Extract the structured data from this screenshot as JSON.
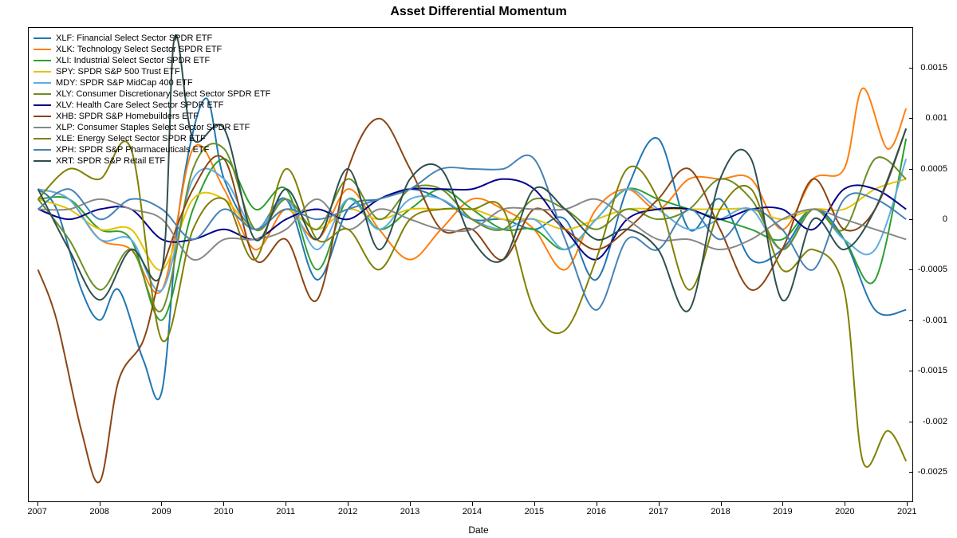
{
  "chart_data": {
    "type": "line",
    "title": "Asset Differential Momentum",
    "xlabel": "Date",
    "ylabel": "",
    "x_years": [
      2007,
      2008,
      2009,
      2010,
      2011,
      2012,
      2013,
      2014,
      2015,
      2016,
      2017,
      2018,
      2019,
      2020,
      2021
    ],
    "x_range": [
      2006.85,
      2021.1
    ],
    "ylim": [
      -0.0028,
      0.0019
    ],
    "yticks": [
      -0.0025,
      -0.002,
      -0.0015,
      -0.001,
      -0.0005,
      0,
      0.0005,
      0.001,
      0.0015
    ],
    "series": [
      {
        "ticker": "XLF",
        "name": "XLF: Financial Select Sector SPDR ETF",
        "color": "#1f77b4",
        "x": [
          2007,
          2007.3,
          2007.7,
          2008,
          2008.3,
          2008.7,
          2009,
          2009.3,
          2009.7,
          2010,
          2010.5,
          2011,
          2011.5,
          2012,
          2012.5,
          2013,
          2013.5,
          2014,
          2014.5,
          2015,
          2015.5,
          2016,
          2016.5,
          2017,
          2017.5,
          2018,
          2018.5,
          2019,
          2019.5,
          2020,
          2020.5,
          2021
        ],
        "y": [
          0.0003,
          0.0001,
          -0.0007,
          -0.001,
          -0.0007,
          -0.0014,
          -0.0017,
          0.0002,
          0.0012,
          0.0004,
          -0.0001,
          0.0002,
          -0.0006,
          0.0001,
          0.0002,
          0.0003,
          0.0002,
          0.0,
          0.0,
          -0.0001,
          0.0,
          -0.0006,
          0.0003,
          0.0008,
          -0.0001,
          0.0002,
          -0.0004,
          -0.0003,
          0.0001,
          -0.0002,
          -0.0009,
          -0.0009
        ]
      },
      {
        "ticker": "XLK",
        "name": "XLK: Technology Select Sector SPDR ETF",
        "color": "#ff7f0e",
        "x": [
          2007,
          2007.5,
          2008,
          2008.5,
          2009,
          2009.5,
          2010,
          2010.5,
          2011,
          2011.5,
          2012,
          2012.5,
          2013,
          2013.5,
          2014,
          2014.5,
          2015,
          2015.5,
          2016,
          2016.5,
          2017,
          2017.5,
          2018,
          2018.5,
          2019,
          2019.5,
          2020,
          2020.3,
          2020.7,
          2021
        ],
        "y": [
          0.0003,
          0.0002,
          -0.0002,
          -0.0003,
          -0.0007,
          0.0007,
          0.0003,
          -0.0003,
          0.0001,
          -0.0002,
          0.0003,
          -0.0001,
          -0.0004,
          -0.0001,
          0.0002,
          0.0001,
          -0.0001,
          -0.0005,
          0.0001,
          0.0003,
          0.0001,
          0.0004,
          0.0004,
          0.0004,
          -0.0001,
          0.0004,
          0.0005,
          0.0013,
          0.0007,
          0.0011
        ]
      },
      {
        "ticker": "XLI",
        "name": "XLI: Industrial Select Sector SPDR ETF",
        "color": "#2ca02c",
        "x": [
          2007,
          2007.5,
          2008,
          2008.5,
          2009,
          2009.5,
          2010,
          2010.5,
          2011,
          2011.5,
          2012,
          2012.5,
          2013,
          2013.5,
          2014,
          2014.5,
          2015,
          2015.5,
          2016,
          2016.5,
          2017,
          2017.5,
          2018,
          2018.5,
          2019,
          2019.5,
          2020,
          2020.5,
          2021
        ],
        "y": [
          0.0002,
          0.0002,
          -0.0001,
          -0.0002,
          -0.001,
          0.0001,
          0.0006,
          0.0001,
          0.0003,
          -0.0005,
          0.0002,
          -0.0001,
          0.0001,
          0.0003,
          0.0001,
          -0.0001,
          -0.0001,
          -0.0003,
          0.0,
          0.0003,
          0.0002,
          0.0001,
          0.0,
          -0.0001,
          -0.0002,
          0.0001,
          -0.0002,
          -0.0006,
          0.0008
        ]
      },
      {
        "ticker": "SPY",
        "name": "SPY: SPDR S&P 500 Trust ETF",
        "color": "#e6c200",
        "x": [
          2007,
          2007.5,
          2008,
          2008.5,
          2009,
          2009.5,
          2010,
          2010.5,
          2011,
          2011.5,
          2012,
          2012.5,
          2013,
          2013.5,
          2014,
          2014.5,
          2015,
          2015.5,
          2016,
          2016.5,
          2017,
          2017.5,
          2018,
          2018.5,
          2019,
          2019.5,
          2020,
          2020.5,
          2021
        ],
        "y": [
          0.0002,
          0.0001,
          -0.0001,
          -0.0001,
          -0.0005,
          0.0002,
          0.0002,
          -0.0001,
          0.0001,
          -0.0001,
          0.0001,
          0.0,
          0.0001,
          0.0001,
          0.0001,
          0.0,
          0.0,
          -0.0001,
          0.0,
          0.0001,
          0.0001,
          0.0001,
          0.0001,
          0.0001,
          0.0,
          0.0001,
          0.0001,
          0.0003,
          0.0004
        ]
      },
      {
        "ticker": "MDY",
        "name": "MDY: SPDR S&P MidCap 400 ETF",
        "color": "#5dade2",
        "x": [
          2007,
          2007.5,
          2008,
          2008.5,
          2009,
          2009.5,
          2010,
          2010.5,
          2011,
          2011.5,
          2012,
          2012.5,
          2013,
          2013.5,
          2014,
          2014.5,
          2015,
          2015.5,
          2016,
          2016.5,
          2017,
          2017.5,
          2018,
          2018.5,
          2019,
          2019.5,
          2020,
          2020.5,
          2021
        ],
        "y": [
          0.0003,
          0.0002,
          -0.0002,
          -0.0002,
          -0.0007,
          0.0004,
          0.0004,
          -0.0001,
          0.0002,
          -0.0003,
          0.0002,
          -0.0001,
          0.0002,
          0.0002,
          0.0,
          -0.0001,
          0.0,
          -0.0003,
          0.0,
          0.0003,
          0.0001,
          -0.0001,
          0.0,
          0.0001,
          -0.0003,
          0.0001,
          -0.0002,
          -0.0003,
          0.0006
        ]
      },
      {
        "ticker": "XLY",
        "name": "XLY: Consumer Discretionary Select Sector SPDR ETF",
        "color": "#6b8e23",
        "x": [
          2007,
          2007.5,
          2008,
          2008.5,
          2009,
          2009.5,
          2010,
          2010.5,
          2011,
          2011.5,
          2012,
          2012.5,
          2013,
          2013.5,
          2014,
          2014.5,
          2015,
          2015.5,
          2016,
          2016.5,
          2017,
          2017.5,
          2018,
          2018.5,
          2019,
          2019.5,
          2020,
          2020.5,
          2021
        ],
        "y": [
          0.0002,
          -0.0002,
          -0.0007,
          -0.0003,
          -0.0009,
          0.0005,
          0.0007,
          -0.0001,
          0.0002,
          -0.0001,
          0.0004,
          0.0,
          0.0003,
          0.0003,
          0.0,
          -0.0001,
          0.0002,
          0.0001,
          -0.0001,
          0.0001,
          0.0,
          0.0001,
          0.0004,
          0.0002,
          -0.0003,
          0.0001,
          -0.0001,
          0.0006,
          0.0004
        ]
      },
      {
        "ticker": "XLV",
        "name": "XLV: Health Care Select Sector SPDR ETF",
        "color": "#00008b",
        "x": [
          2007,
          2007.5,
          2008,
          2008.5,
          2009,
          2009.5,
          2010,
          2010.5,
          2011,
          2011.5,
          2012,
          2012.5,
          2013,
          2013.5,
          2014,
          2014.5,
          2015,
          2015.5,
          2016,
          2016.5,
          2017,
          2017.5,
          2018,
          2018.5,
          2019,
          2019.5,
          2020,
          2020.5,
          2021
        ],
        "y": [
          0.0001,
          0.0,
          0.0001,
          0.0001,
          -0.0002,
          -0.0002,
          -0.0001,
          -0.0002,
          0.0,
          0.0001,
          0.0,
          0.0002,
          0.0003,
          0.0003,
          0.0003,
          0.0004,
          0.0003,
          -0.0001,
          -0.0004,
          0.0,
          0.0001,
          0.0001,
          0.0,
          0.0001,
          0.0001,
          -0.0001,
          0.0003,
          0.0003,
          0.0001
        ]
      },
      {
        "ticker": "XHB",
        "name": "XHB: SPDR S&P Homebuilders ETF",
        "color": "#8b4513",
        "x": [
          2007,
          2007.3,
          2007.7,
          2008,
          2008.3,
          2008.7,
          2009,
          2009.5,
          2010,
          2010.5,
          2011,
          2011.5,
          2012,
          2012.5,
          2013,
          2013.5,
          2014,
          2014.5,
          2015,
          2015.5,
          2016,
          2016.5,
          2017,
          2017.5,
          2018,
          2018.5,
          2019,
          2019.5,
          2020,
          2020.5,
          2021
        ],
        "y": [
          -0.0005,
          -0.001,
          -0.0021,
          -0.0026,
          -0.0016,
          -0.0012,
          -0.0005,
          0.0003,
          0.0006,
          -0.0004,
          -0.0002,
          -0.0008,
          0.0005,
          0.001,
          0.0005,
          -0.0001,
          -0.0001,
          -0.0004,
          0.0001,
          -0.0001,
          -0.0003,
          -0.0001,
          0.0002,
          0.0005,
          -0.0001,
          -0.0007,
          -0.0003,
          0.0004,
          -0.0001,
          0.0001,
          0.0009
        ]
      },
      {
        "ticker": "XLP",
        "name": "XLP: Consumer Staples Select Sector SPDR ETF",
        "color": "#888888",
        "x": [
          2007,
          2007.5,
          2008,
          2008.5,
          2009,
          2009.5,
          2010,
          2010.5,
          2011,
          2011.5,
          2012,
          2012.5,
          2013,
          2013.5,
          2014,
          2014.5,
          2015,
          2015.5,
          2016,
          2016.5,
          2017,
          2017.5,
          2018,
          2018.5,
          2019,
          2019.5,
          2020,
          2020.5,
          2021
        ],
        "y": [
          0.0001,
          0.0001,
          0.0002,
          0.0001,
          0.0,
          -0.0004,
          -0.0002,
          -0.0002,
          -0.0001,
          0.0002,
          -0.0001,
          0.0001,
          0.0,
          -0.0001,
          -0.0001,
          0.0001,
          0.0001,
          0.0001,
          0.0002,
          0.0,
          -0.0002,
          -0.0002,
          -0.0003,
          -0.0002,
          0.0,
          0.0001,
          0.0,
          -0.0001,
          -0.0002
        ]
      },
      {
        "ticker": "XLE",
        "name": "XLE: Energy Select Sector SPDR ETF",
        "color": "#808000",
        "x": [
          2007,
          2007.5,
          2008,
          2008.5,
          2009,
          2009.5,
          2010,
          2010.5,
          2011,
          2011.5,
          2012,
          2012.5,
          2013,
          2013.5,
          2014,
          2014.5,
          2015,
          2015.5,
          2016,
          2016.5,
          2017,
          2017.5,
          2018,
          2018.5,
          2019,
          2019.5,
          2020,
          2020.3,
          2020.7,
          2021
        ],
        "y": [
          0.0002,
          0.0005,
          0.0004,
          0.0007,
          -0.0012,
          -0.0001,
          0.0002,
          -0.0004,
          0.0005,
          -0.0002,
          -0.0001,
          -0.0005,
          0.0,
          0.0001,
          0.0001,
          0.0001,
          -0.0009,
          -0.0011,
          -0.0004,
          0.0005,
          0.0002,
          -0.0007,
          0.0001,
          0.0003,
          -0.0005,
          -0.0003,
          -0.0007,
          -0.0024,
          -0.0021,
          -0.0024
        ]
      },
      {
        "ticker": "XPH",
        "name": "XPH: SPDR S&P Pharmaceuticals ETF",
        "color": "#4682b4",
        "x": [
          2007,
          2007.5,
          2008,
          2008.5,
          2009,
          2009.5,
          2010,
          2010.5,
          2011,
          2011.5,
          2012,
          2012.5,
          2013,
          2013.5,
          2014,
          2014.5,
          2015,
          2015.5,
          2016,
          2016.5,
          2017,
          2017.5,
          2018,
          2018.5,
          2019,
          2019.5,
          2020,
          2020.5,
          2021
        ],
        "y": [
          0.0001,
          0.0003,
          0.0,
          0.0002,
          0.0001,
          -0.0002,
          0.0001,
          -0.0001,
          0.0001,
          0.0,
          0.0001,
          0.0002,
          0.0003,
          0.0005,
          0.0005,
          0.0005,
          0.0006,
          -0.0002,
          -0.0009,
          -0.0002,
          -0.0003,
          0.0001,
          -0.0002,
          0.0001,
          -0.0001,
          -0.0005,
          0.0002,
          0.0002,
          0.0
        ]
      },
      {
        "ticker": "XRT",
        "name": "XRT: SPDR S&P Retail ETF",
        "color": "#2f4f4f",
        "x": [
          2007,
          2007.5,
          2008,
          2008.5,
          2009,
          2009.2,
          2009.5,
          2010,
          2010.5,
          2011,
          2011.5,
          2012,
          2012.5,
          2013,
          2013.5,
          2014,
          2014.5,
          2015,
          2015.5,
          2016,
          2016.5,
          2017,
          2017.5,
          2018,
          2018.5,
          2019,
          2019.5,
          2020,
          2020.5,
          2021
        ],
        "y": [
          0.0003,
          -0.0003,
          -0.0008,
          -0.0003,
          -0.0005,
          0.0018,
          0.0008,
          0.0009,
          -0.0002,
          0.0003,
          -0.0002,
          0.0005,
          -0.0003,
          0.0004,
          0.0005,
          -0.0002,
          -0.0004,
          0.0003,
          0.0001,
          -0.0002,
          -0.0001,
          -0.0003,
          -0.0009,
          0.0004,
          0.0006,
          -0.0008,
          0.0,
          -0.0003,
          0.0001,
          0.0009
        ]
      }
    ]
  }
}
